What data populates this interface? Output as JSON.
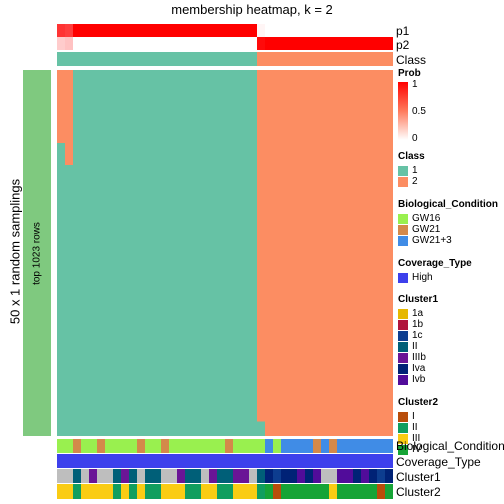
{
  "title": "membership heatmap, k = 2",
  "left_label": "50 x 1 random samplings",
  "row_annotation_label": "top 1023 rows",
  "top_rows": [
    {
      "label": "p1"
    },
    {
      "label": "p2"
    },
    {
      "label": "Class"
    }
  ],
  "bottom_rows": [
    {
      "label": "Biological_Condition"
    },
    {
      "label": "Coverage_Type"
    },
    {
      "label": "Cluster1"
    },
    {
      "label": "Cluster2"
    }
  ],
  "colors": {
    "class_1": "#66C2A5",
    "class_2": "#FC8D62",
    "row_anno": "#7FC97F",
    "prob_high": "#FF0000",
    "prob_low": "#FFFFFF"
  },
  "legends": {
    "prob": {
      "title": "Prob",
      "ticks": [
        "1",
        "0.5",
        "0"
      ]
    },
    "class": {
      "title": "Class",
      "items": [
        {
          "label": "1",
          "color": "#66C2A5"
        },
        {
          "label": "2",
          "color": "#FC8D62"
        }
      ]
    },
    "bio": {
      "title": "Biological_Condition",
      "items": [
        {
          "label": "GW16",
          "color": "#99F04F"
        },
        {
          "label": "GW21",
          "color": "#D4894A"
        },
        {
          "label": "GW21+3",
          "color": "#408CE6"
        }
      ]
    },
    "coverage": {
      "title": "Coverage_Type",
      "items": [
        {
          "label": "High",
          "color": "#3D40EC"
        }
      ]
    },
    "cluster1": {
      "title": "Cluster1",
      "items": [
        {
          "label": "1a",
          "color": "#E6B800"
        },
        {
          "label": "1b",
          "color": "#B0143C"
        },
        {
          "label": "1c",
          "color": "#0D3D8F"
        },
        {
          "label": "II",
          "color": "#005F78"
        },
        {
          "label": "IIIb",
          "color": "#6A1596"
        },
        {
          "label": "Iva",
          "color": "#002276"
        },
        {
          "label": "Ivb",
          "color": "#510C9A"
        }
      ]
    },
    "cluster2": {
      "title": "Cluster2",
      "items": [
        {
          "label": "I",
          "color": "#B84D0A"
        },
        {
          "label": "II",
          "color": "#109E5F"
        },
        {
          "label": "III",
          "color": "#FACC14"
        },
        {
          "label": "IV",
          "color": "#16A436"
        }
      ]
    }
  },
  "chart_data": {
    "type": "heatmap",
    "title": "membership heatmap, k = 2",
    "ylabel": "50 x 1 random samplings",
    "n_columns": 42,
    "columns": {
      "p1": [
        0.8,
        0.76,
        1,
        1,
        1,
        1,
        1,
        1,
        1,
        1,
        1,
        1,
        1,
        1,
        1,
        1,
        1,
        1,
        1,
        1,
        1,
        1,
        1,
        1,
        1,
        0.04,
        0,
        0,
        0,
        0,
        0,
        0,
        0,
        0,
        0,
        0,
        0,
        0,
        0,
        0,
        0,
        0
      ],
      "p2": [
        0.2,
        0.24,
        0,
        0,
        0,
        0,
        0,
        0,
        0,
        0,
        0,
        0,
        0,
        0,
        0,
        0,
        0,
        0,
        0,
        0,
        0,
        0,
        0,
        0,
        0,
        0.96,
        1,
        1,
        1,
        1,
        1,
        1,
        1,
        1,
        1,
        1,
        1,
        1,
        1,
        1,
        1,
        1
      ],
      "class": [
        1,
        1,
        1,
        1,
        1,
        1,
        1,
        1,
        1,
        1,
        1,
        1,
        1,
        1,
        1,
        1,
        1,
        1,
        1,
        1,
        1,
        1,
        1,
        1,
        1,
        2,
        2,
        2,
        2,
        2,
        2,
        2,
        2,
        2,
        2,
        2,
        2,
        2,
        2,
        2,
        2,
        2
      ],
      "biological_condition": [
        "GW16",
        "GW16",
        "GW21",
        "GW16",
        "GW16",
        "GW21",
        "GW16",
        "GW16",
        "GW16",
        "GW16",
        "GW21",
        "GW16",
        "GW16",
        "GW21",
        "GW16",
        "GW16",
        "GW16",
        "GW16",
        "GW16",
        "GW16",
        "GW16",
        "GW21",
        "GW16",
        "GW16",
        "GW16",
        "GW16",
        "GW21+3",
        "GW16",
        "GW21+3",
        "GW21+3",
        "GW21+3",
        "GW21+3",
        "GW21",
        "GW21+3",
        "GW21",
        "GW21+3",
        "GW21+3",
        "GW21+3",
        "GW21+3",
        "GW21+3",
        "GW21+3",
        "GW21+3"
      ],
      "coverage_type": [
        "High",
        "High",
        "High",
        "High",
        "High",
        "High",
        "High",
        "High",
        "High",
        "High",
        "High",
        "High",
        "High",
        "High",
        "High",
        "High",
        "High",
        "High",
        "High",
        "High",
        "High",
        "High",
        "High",
        "High",
        "High",
        "High",
        "High",
        "High",
        "High",
        "High",
        "High",
        "High",
        "High",
        "High",
        "High",
        "High",
        "High",
        "High",
        "High",
        "High",
        "High",
        "High"
      ],
      "cluster1": [
        "NA",
        "NA",
        "II",
        "NA",
        "IIIb",
        "NA",
        "NA",
        "II",
        "IIIb",
        "II",
        "NA",
        "II",
        "II",
        "NA",
        "NA",
        "IIIb",
        "II",
        "II",
        "NA",
        "IIIb",
        "II",
        "II",
        "IIIb",
        "IIIb",
        "NA",
        "II",
        "Iva",
        "1c",
        "Iva",
        "Iva",
        "Ivb",
        "Iva",
        "Ivb",
        "NA",
        "NA",
        "Ivb",
        "Ivb",
        "Iva",
        "Ivb",
        "Iva",
        "1c",
        "Iva"
      ],
      "cluster2": [
        "III",
        "III",
        "II",
        "III",
        "III",
        "III",
        "III",
        "II",
        "III",
        "II",
        "III",
        "II",
        "II",
        "III",
        "III",
        "III",
        "II",
        "II",
        "III",
        "III",
        "II",
        "II",
        "III",
        "III",
        "III",
        "II",
        "IV",
        "I",
        "IV",
        "IV",
        "IV",
        "IV",
        "IV",
        "IV",
        "III",
        "IV",
        "IV",
        "IV",
        "IV",
        "IV",
        "I",
        "IV"
      ]
    },
    "rows_matrix": {
      "n_rows": 50,
      "description": "Class membership per sampling; class 1 columns teal, class 2 columns orange",
      "exceptions": [
        {
          "column": 0,
          "rows_class_2_fraction_from_top": 0.2
        },
        {
          "column": 1,
          "rows_class_2_fraction_from_top": 0.26
        },
        {
          "column": 25,
          "rows_class_1_fraction_from_bottom": 0.04
        }
      ]
    },
    "legend_placement": "right"
  }
}
